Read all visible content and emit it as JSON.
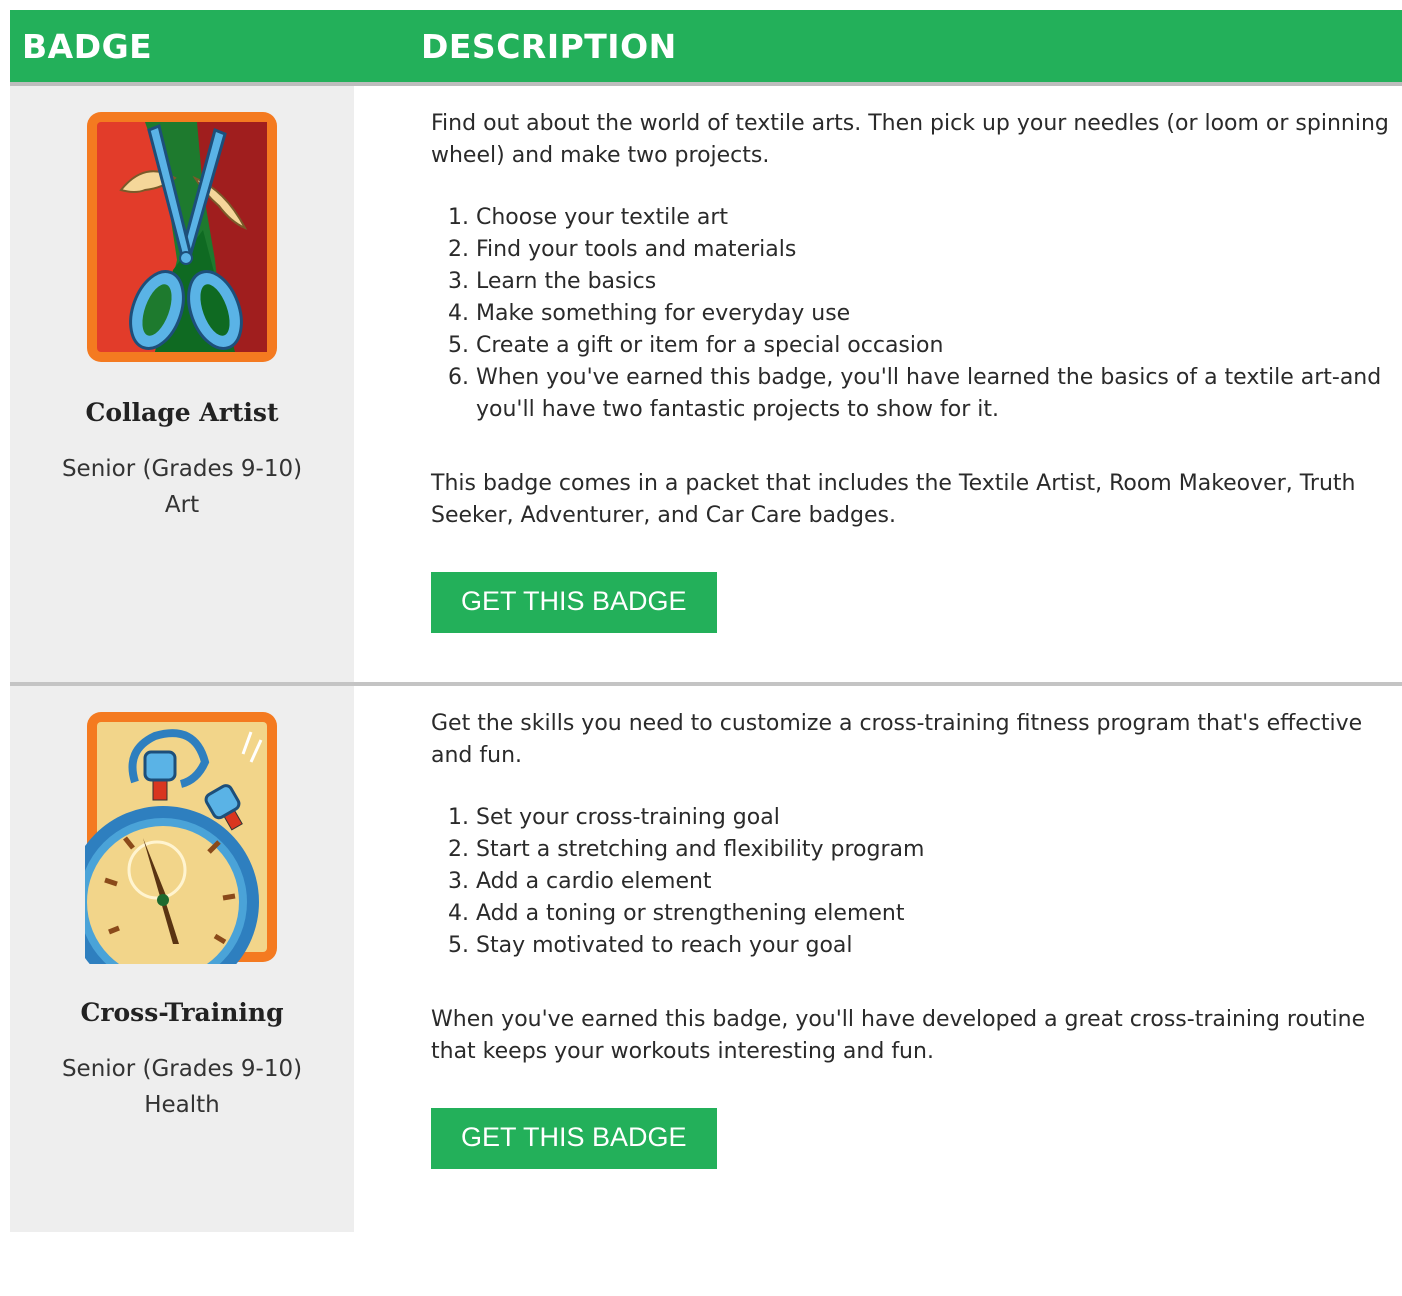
{
  "table": {
    "header": {
      "badge": "BADGE",
      "description": "DESCRIPTION"
    },
    "rows": [
      {
        "badge_name": "Collage Artist",
        "level": "Senior (Grades 9-10)",
        "category": "Art",
        "intro": "Find out about the world of textile arts. Then pick up your needles (or loom or spinning wheel) and make two projects.",
        "steps": [
          "Choose your textile art",
          "Find your tools and materials",
          "Learn the basics",
          "Make something for everyday use",
          "Create a gift or item for a special occasion",
          "When you've earned this badge, you'll have learned the basics of a textile art-and you'll have two fantastic projects to show for it."
        ],
        "outro": "This badge comes in a packet that includes the Textile Artist, Room Makeover, Truth Seeker, Adventurer, and Car Care badges.",
        "button": "GET THIS BADGE"
      },
      {
        "badge_name": "Cross-Training",
        "level": "Senior (Grades 9-10)",
        "category": "Health",
        "intro": "Get the skills you need to customize a cross-training fitness program that's effective and fun.",
        "steps": [
          "Set your cross-training goal",
          "Start a stretching and flexibility program",
          "Add a cardio element",
          "Add a toning or strengthening element",
          "Stay motivated to reach your goal"
        ],
        "outro": "When you've earned this badge, you'll have developed a great cross-training routine that keeps your workouts interesting and fun.",
        "button": "GET THIS BADGE"
      }
    ]
  },
  "colors": {
    "accent_green": "#23b05a",
    "badge_border_orange": "#f47a20",
    "badge_cell_bg": "#eeeeee"
  },
  "icons": [
    "scissors-badge-icon",
    "stopwatch-badge-icon"
  ]
}
